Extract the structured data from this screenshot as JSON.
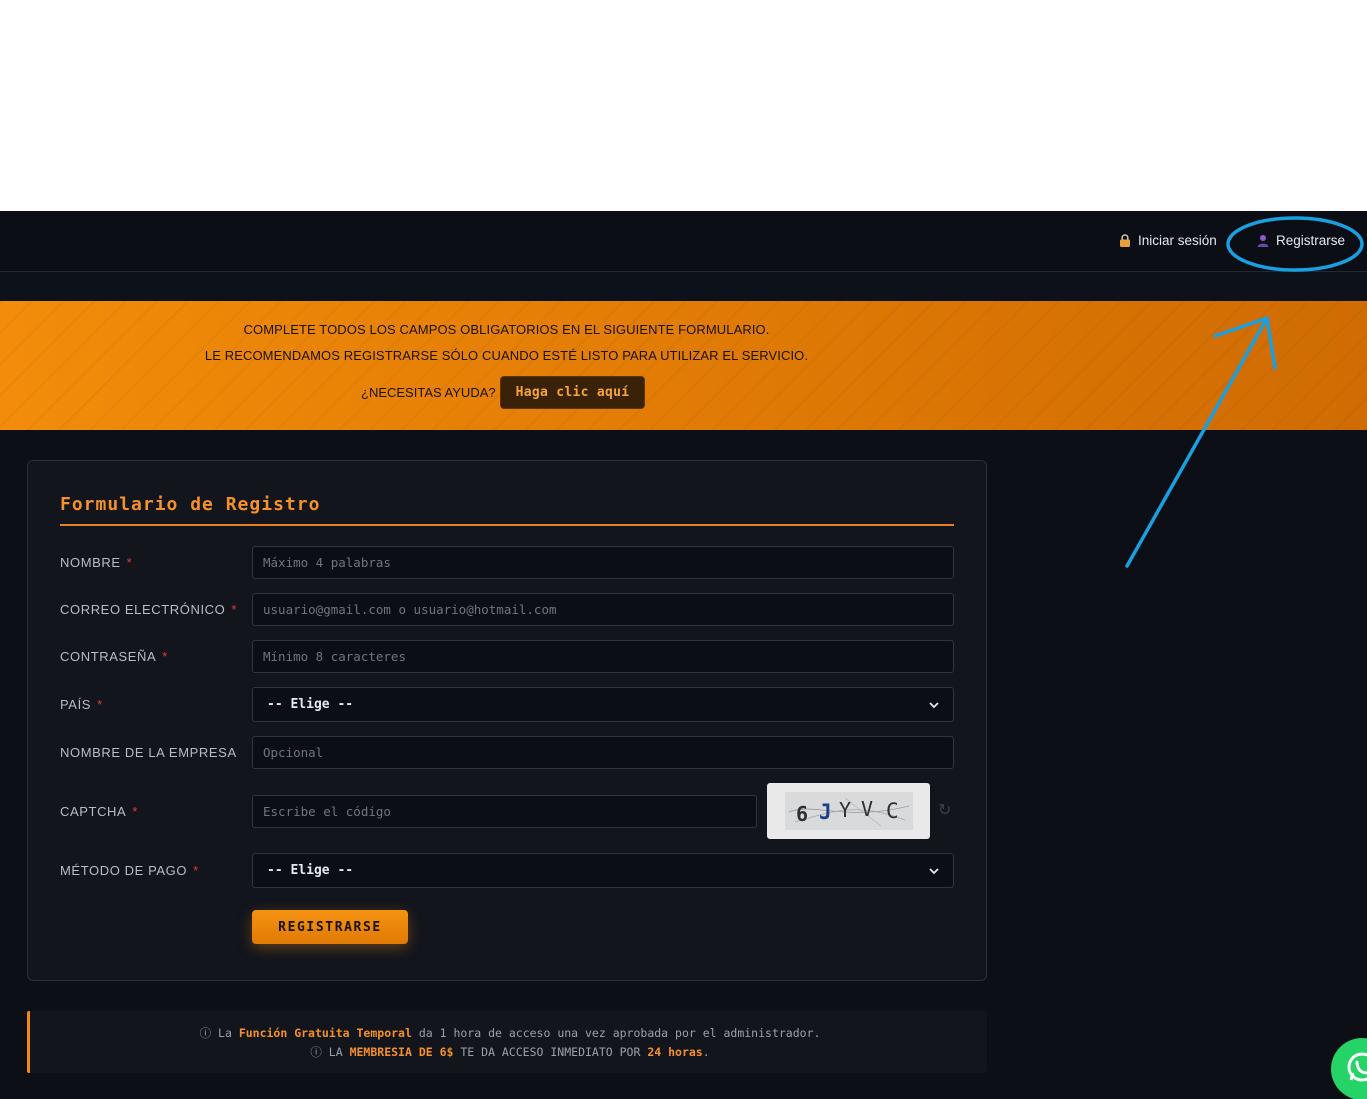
{
  "nav": {
    "login_label": "Iniciar sesión",
    "register_label": "Registrarse"
  },
  "banner": {
    "line1": "COMPLETE TODOS LOS CAMPOS OBLIGATORIOS EN EL SIGUIENTE FORMULARIO.",
    "line2": "LE RECOMENDAMOS REGISTRARSE SÓLO CUANDO ESTÉ LISTO PARA UTILIZAR EL SERVICIO.",
    "help_text": "¿NECESITAS AYUDA?",
    "help_button": "Haga clic aquí"
  },
  "form": {
    "title": "Formulario de Registro",
    "required_mark": "*",
    "fields": {
      "name": {
        "label": "NOMBRE",
        "placeholder": "Máximo 4 palabras"
      },
      "email": {
        "label": "CORREO ELECTRÓNICO",
        "placeholder": "usuario@gmail.com o usuario@hotmail.com"
      },
      "password": {
        "label": "CONTRASEÑA",
        "placeholder": "Mínimo 8 caracteres"
      },
      "country": {
        "label": "PAÍS",
        "selected": "-- Elige --"
      },
      "company": {
        "label": "NOMBRE DE LA EMPRESA",
        "placeholder": "Opcional"
      },
      "captcha": {
        "label": "CAPTCHA",
        "placeholder": "Escribe el código",
        "code": [
          "6",
          "J",
          "Y",
          "V",
          "C"
        ]
      },
      "payment": {
        "label": "MÉTODO DE PAGO",
        "selected": "-- Elige --"
      }
    },
    "submit_label": "REGISTRARSE"
  },
  "notice": {
    "line1": {
      "info_icon": "ⓘ",
      "prefix": "La",
      "highlight": "Función Gratuita Temporal",
      "suffix": "da 1 hora de acceso una vez aprobada por el administrador."
    },
    "line2": {
      "info_icon": "ⓘ",
      "prefix": "LA",
      "highlight1": "MEMBRESIA DE 6$",
      "middle": "TE DA ACCESO INMEDIATO POR",
      "highlight2": "24 horas",
      "suffix": "."
    }
  },
  "colors": {
    "accent": "#f5902a",
    "banner_orange": "#e37d05",
    "background": "#0c0f16",
    "annotation_blue": "#1a9fe0",
    "required_red": "#e23b3b",
    "whatsapp_green": "#25d366"
  },
  "icons": {
    "login": "lock-icon",
    "register": "user-icon",
    "refresh": "refresh-icon",
    "whatsapp": "whatsapp-icon",
    "select": "chevron-down-icon"
  }
}
